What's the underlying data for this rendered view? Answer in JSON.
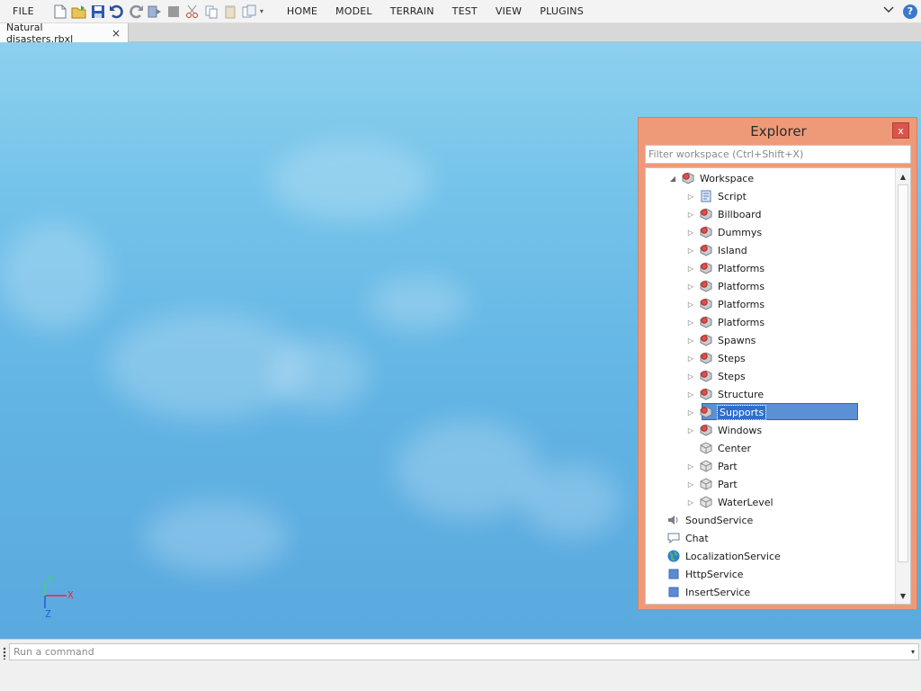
{
  "menubar": {
    "file_label": "FILE",
    "tabs": [
      "HOME",
      "MODEL",
      "TERRAIN",
      "TEST",
      "VIEW",
      "PLUGINS"
    ]
  },
  "document_tab": {
    "title": "Natural disasters.rbxl",
    "close": "×"
  },
  "viewport": {
    "axis": {
      "x": "X",
      "y": "Y",
      "z": "Z",
      "x_color": "#e8283a",
      "y_color": "#45d07a",
      "z_color": "#2a58d9"
    }
  },
  "explorer": {
    "title": "Explorer",
    "close": "x",
    "filter_placeholder": "Filter workspace (Ctrl+Shift+X)",
    "items": [
      {
        "name": "Workspace",
        "depth": 1,
        "expander": "open",
        "icon": "model-icon"
      },
      {
        "name": "Script",
        "depth": 2,
        "expander": "closed",
        "icon": "script-icon"
      },
      {
        "name": "Billboard",
        "depth": 2,
        "expander": "closed",
        "icon": "model-icon"
      },
      {
        "name": "Dummys",
        "depth": 2,
        "expander": "closed",
        "icon": "model-icon"
      },
      {
        "name": "Island",
        "depth": 2,
        "expander": "closed",
        "icon": "model-icon"
      },
      {
        "name": "Platforms",
        "depth": 2,
        "expander": "closed",
        "icon": "model-icon"
      },
      {
        "name": "Platforms",
        "depth": 2,
        "expander": "closed",
        "icon": "model-icon"
      },
      {
        "name": "Platforms",
        "depth": 2,
        "expander": "closed",
        "icon": "model-icon"
      },
      {
        "name": "Platforms",
        "depth": 2,
        "expander": "closed",
        "icon": "model-icon"
      },
      {
        "name": "Spawns",
        "depth": 2,
        "expander": "closed",
        "icon": "model-icon"
      },
      {
        "name": "Steps",
        "depth": 2,
        "expander": "closed",
        "icon": "model-icon"
      },
      {
        "name": "Steps",
        "depth": 2,
        "expander": "closed",
        "icon": "model-icon"
      },
      {
        "name": "Structure",
        "depth": 2,
        "expander": "closed",
        "icon": "model-icon"
      },
      {
        "name": "Supports",
        "depth": 2,
        "expander": "closed",
        "icon": "model-icon",
        "selected": true
      },
      {
        "name": "Windows",
        "depth": 2,
        "expander": "closed",
        "icon": "model-icon"
      },
      {
        "name": "Center",
        "depth": 2,
        "expander": "none",
        "icon": "part-icon"
      },
      {
        "name": "Part",
        "depth": 2,
        "expander": "closed",
        "icon": "part-icon"
      },
      {
        "name": "Part",
        "depth": 2,
        "expander": "closed",
        "icon": "part-icon"
      },
      {
        "name": "WaterLevel",
        "depth": 2,
        "expander": "closed",
        "icon": "part-icon"
      },
      {
        "name": "SoundService",
        "depth": 0,
        "expander": "none",
        "icon": "speaker-icon"
      },
      {
        "name": "Chat",
        "depth": 0,
        "expander": "none",
        "icon": "chat-icon"
      },
      {
        "name": "LocalizationService",
        "depth": 0,
        "expander": "none",
        "icon": "globe-icon"
      },
      {
        "name": "HttpService",
        "depth": 0,
        "expander": "none",
        "icon": "service-icon"
      },
      {
        "name": "InsertService",
        "depth": 0,
        "expander": "none",
        "icon": "service-icon"
      }
    ]
  },
  "command_bar": {
    "placeholder": "Run a command"
  }
}
